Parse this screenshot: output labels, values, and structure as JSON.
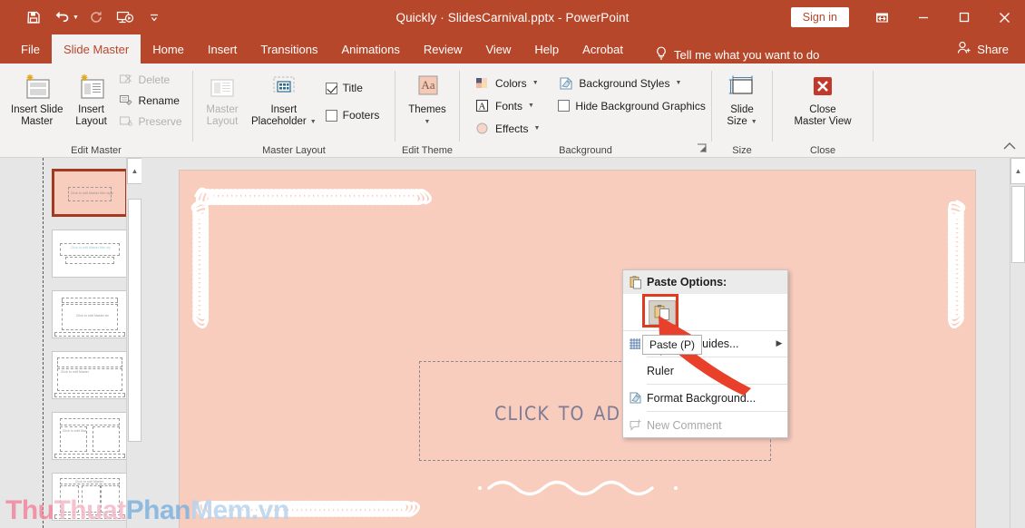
{
  "titlebar": {
    "document_title": "Quickly · SlidesCarnival.pptx  -  PowerPoint",
    "quick_access": [
      {
        "name": "save-icon",
        "label": "Save"
      },
      {
        "name": "undo-icon",
        "label": "Undo"
      },
      {
        "name": "redo-icon",
        "label": "Redo"
      },
      {
        "name": "start-presentation-icon",
        "label": "Start From Beginning"
      },
      {
        "name": "customize-quick-access-icon",
        "label": "Customize Quick Access Toolbar"
      }
    ],
    "sign_in": "Sign in",
    "ribbon_display_options": "Ribbon Display Options",
    "minimize": "Minimize",
    "restore": "Restore Down",
    "close": "Close",
    "accent_color": "#b7472a"
  },
  "tabs": [
    {
      "label": "File",
      "active": false
    },
    {
      "label": "Slide Master",
      "active": true
    },
    {
      "label": "Home",
      "active": false
    },
    {
      "label": "Insert",
      "active": false
    },
    {
      "label": "Transitions",
      "active": false
    },
    {
      "label": "Animations",
      "active": false
    },
    {
      "label": "Review",
      "active": false
    },
    {
      "label": "View",
      "active": false
    },
    {
      "label": "Help",
      "active": false
    },
    {
      "label": "Acrobat",
      "active": false
    }
  ],
  "tell_me": "Tell me what you want to do",
  "share": "Share",
  "ribbon": {
    "groups": [
      {
        "label": "Edit Master",
        "big_buttons": [
          {
            "label_line1": "Insert Slide",
            "label_line2": "Master",
            "disabled": false
          },
          {
            "label_line1": "Insert",
            "label_line2": "Layout",
            "disabled": false
          }
        ],
        "small_buttons": [
          {
            "label": "Delete",
            "icon": "delete-slide-icon",
            "disabled": true
          },
          {
            "label": "Rename",
            "icon": "rename-icon",
            "disabled": false
          },
          {
            "label": "Preserve",
            "icon": "preserve-icon",
            "disabled": true
          }
        ]
      },
      {
        "label": "Master Layout",
        "big_buttons": [
          {
            "label_line1": "Master",
            "label_line2": "Layout",
            "disabled": true
          },
          {
            "label_line1": "Insert",
            "label_line2": "Placeholder",
            "disabled": false,
            "has_caret": true
          }
        ],
        "checkboxes": [
          {
            "label": "Title",
            "checked": true
          },
          {
            "label": "Footers",
            "checked": false
          }
        ]
      },
      {
        "label": "Edit Theme",
        "big_buttons": [
          {
            "label_line1": "Themes",
            "label_line2": "",
            "disabled": false,
            "has_caret": true
          }
        ]
      },
      {
        "label": "Background",
        "small_buttons": [
          {
            "label": "Colors",
            "icon": "colors-icon",
            "disabled": false,
            "has_caret": true
          },
          {
            "label": "Fonts",
            "icon": "fonts-icon",
            "disabled": false,
            "has_caret": true
          },
          {
            "label": "Effects",
            "icon": "effects-icon",
            "disabled": false,
            "has_caret": true
          }
        ],
        "small_buttons2": [
          {
            "label": "Background Styles",
            "icon": "background-styles-icon",
            "disabled": false,
            "has_caret": true
          },
          {
            "label": "Hide Background Graphics",
            "icon": "checkbox",
            "checked": false
          }
        ],
        "has_dialog_launcher": true
      },
      {
        "label": "Size",
        "big_buttons": [
          {
            "label_line1": "Slide",
            "label_line2": "Size",
            "disabled": false,
            "has_caret": true
          }
        ]
      },
      {
        "label": "Close",
        "big_buttons": [
          {
            "label_line1": "Close",
            "label_line2": "Master View",
            "disabled": false
          }
        ]
      }
    ],
    "collapse_ribbon": "Collapse the Ribbon"
  },
  "thumbnails": {
    "count": 6,
    "selected_index": 0,
    "items": [
      {
        "name": "slide-master-thumbnail",
        "selected": true,
        "title_text": "Click to edit Master title style"
      },
      {
        "name": "title-slide-layout-thumbnail",
        "selected": false,
        "title_text": "Click to edit Master title style"
      },
      {
        "name": "title-and-content-layout-thumbnail",
        "selected": false,
        "title_text": "Click to edit Master text styles"
      },
      {
        "name": "section-header-layout-thumbnail",
        "selected": false,
        "title_text": "Click to edit Master"
      },
      {
        "name": "two-content-layout-thumbnail",
        "selected": false,
        "title_text": "Click to edit Master"
      },
      {
        "name": "comparison-layout-thumbnail",
        "selected": false,
        "title_text": "Click to edit Master"
      }
    ]
  },
  "slide": {
    "background_color": "#f8cdbe",
    "border_decoration": "curly-loop-border",
    "title_placeholder_text": "Click to add title",
    "title_placeholder_color": "#7e7b95",
    "bottom_decoration": "wave-squiggle"
  },
  "context_menu": {
    "header": "Paste Options:",
    "paste_button_tooltip": "Paste (P)",
    "paste_button_name": "paste-keep-source-formatting-button",
    "items": [
      {
        "label": "Grid and Guides...",
        "icon": "grid-icon",
        "disabled": false,
        "has_submenu": true,
        "accel": "G"
      },
      {
        "label": "Ruler",
        "icon": "",
        "disabled": false,
        "has_submenu": false,
        "accel": "R"
      },
      {
        "label": "Format Background...",
        "icon": "format-background-icon",
        "disabled": false,
        "has_submenu": false,
        "accel": "B"
      },
      {
        "label": "New Comment",
        "icon": "new-comment-icon",
        "disabled": true,
        "has_submenu": false,
        "accel": "m"
      }
    ]
  },
  "annotation": {
    "arrow_color": "#e8402a",
    "highlight_color": "#e03a21"
  },
  "watermark": {
    "part1": "Thu",
    "part2": "Thuat",
    "part3": "Phan",
    "part4": "Mem.vn"
  }
}
